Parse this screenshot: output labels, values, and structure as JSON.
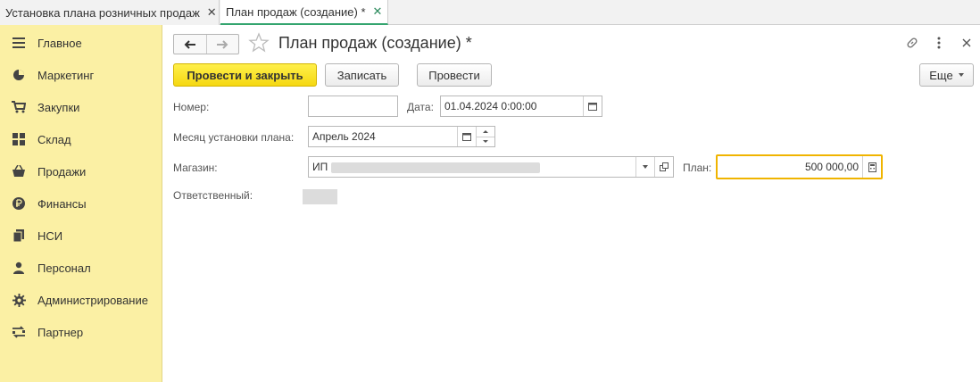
{
  "tabs": [
    {
      "label": "Установка плана розничных продаж",
      "close": "✕"
    },
    {
      "label": "План продаж (создание) *",
      "close": "✕"
    }
  ],
  "sidebar": {
    "items": [
      {
        "label": "Главное",
        "icon": "menu-lines-icon"
      },
      {
        "label": "Маркетинг",
        "icon": "pie-chart-icon"
      },
      {
        "label": "Закупки",
        "icon": "cart-icon"
      },
      {
        "label": "Склад",
        "icon": "warehouse-grid-icon"
      },
      {
        "label": "Продажи",
        "icon": "basket-icon"
      },
      {
        "label": "Финансы",
        "icon": "ruble-icon"
      },
      {
        "label": "НСИ",
        "icon": "documents-icon"
      },
      {
        "label": "Персонал",
        "icon": "person-icon"
      },
      {
        "label": "Администрирование",
        "icon": "gear-icon"
      },
      {
        "label": "Партнер",
        "icon": "partner-icon"
      }
    ]
  },
  "form": {
    "title": "План продаж (создание) *",
    "buttons": {
      "post_close": "Провести и закрыть",
      "save": "Записать",
      "post": "Провести",
      "more": "Еще"
    },
    "fields": {
      "number_label": "Номер:",
      "number_value": "",
      "date_label": "Дата:",
      "date_value": "01.04.2024  0:00:00",
      "month_label": "Месяц установки плана:",
      "month_value": "Апрель 2024",
      "store_label": "Магазин:",
      "store_value": "ИП",
      "plan_label": "План:",
      "plan_value": "500 000,00",
      "responsible_label": "Ответственный:"
    }
  },
  "colors": {
    "sidebar_bg": "#fbf0a4",
    "primary_button": "#f5d812",
    "active_tab_accent": "#34a56f",
    "focused_field_border": "#f0b400"
  }
}
